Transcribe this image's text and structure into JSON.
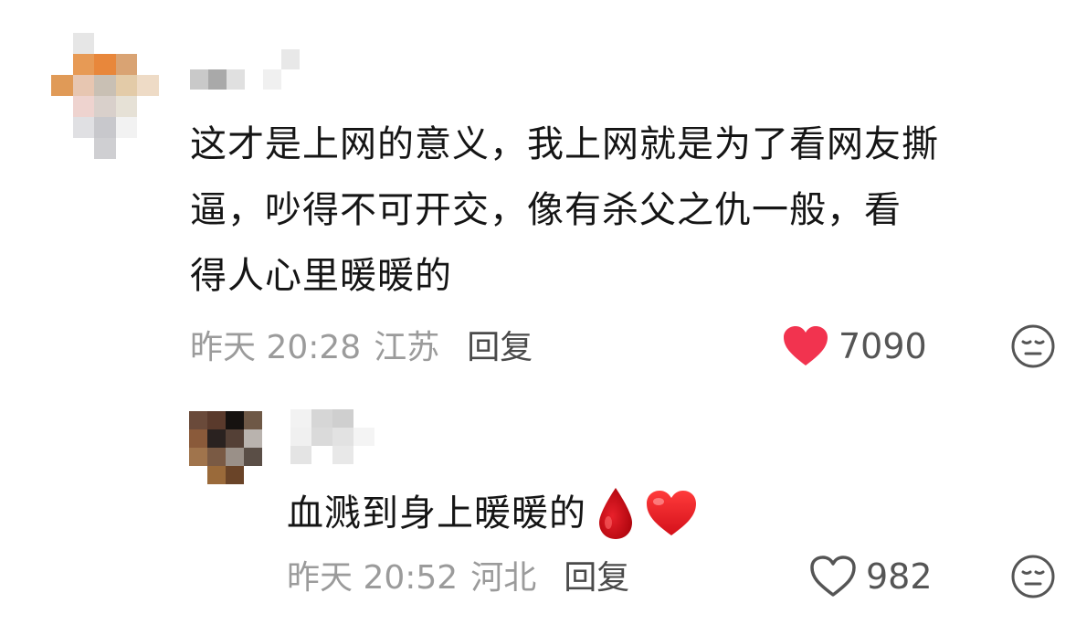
{
  "comments": [
    {
      "text_lines": [
        "这才是上网的意义，我上网就是为了看网友撕",
        "逼，吵得不可开交，像有杀父之仇一般，看",
        "得人心里暖暖的"
      ],
      "time": "昨天 20:28",
      "location": "江苏",
      "reply_label": "回复",
      "likes": "7090",
      "liked": true
    },
    {
      "text": "血溅到身上暖暖的",
      "emojis": [
        "blood-drop-icon",
        "red-heart-icon"
      ],
      "time": "昨天 20:52",
      "location": "河北",
      "reply_label": "回复",
      "likes": "982",
      "liked": false
    }
  ],
  "colors": {
    "text": "#151515",
    "meta": "#9b9b9b",
    "like_active": "#f2334f",
    "icon_gray": "#555555"
  }
}
